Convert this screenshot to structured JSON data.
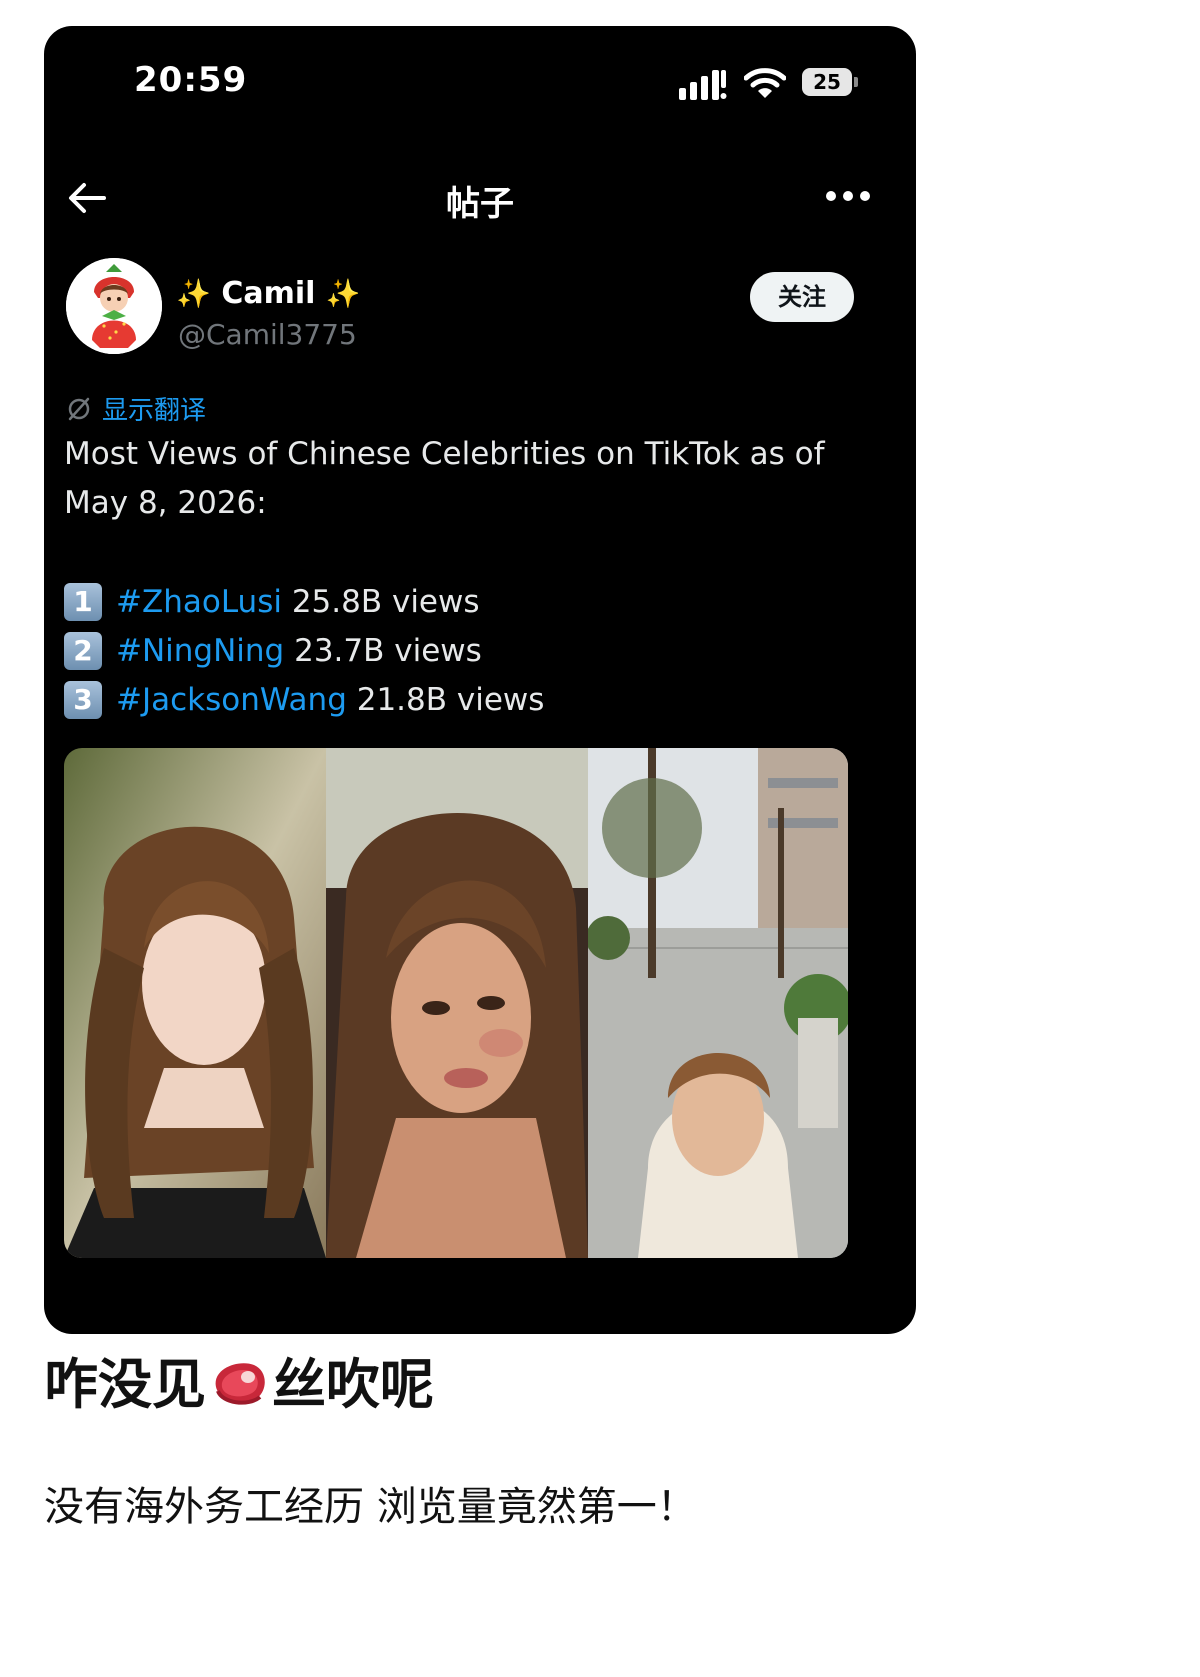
{
  "status_bar": {
    "time": "20:59",
    "battery": "25"
  },
  "nav": {
    "title": "帖子"
  },
  "author": {
    "display_name": "Camil",
    "sparkle": "✨",
    "handle": "@Camil3775",
    "follow_label": "关注"
  },
  "post": {
    "translate_label": "显示翻译",
    "text": "Most Views of Chinese Celebrities on TikTok as of May 8, 2026:",
    "rankings": [
      {
        "num": "1",
        "hashtag": "#ZhaoLusi",
        "views": "25.8B views"
      },
      {
        "num": "2",
        "hashtag": "#NingNing",
        "views": "23.7B views"
      },
      {
        "num": "3",
        "hashtag": "#JacksonWang",
        "views": "21.8B views"
      }
    ]
  },
  "caption": {
    "title_part1": "咋没见",
    "title_part2": "丝吹呢",
    "subtitle": "没有海外务工经历 浏览量竟然第一！"
  },
  "icons": {
    "back": "arrow-left-icon",
    "more": "more-horizontal-icon",
    "translate": "translate-icon",
    "signal": "signal-icon",
    "wifi": "wifi-icon",
    "emoji": "steak-emoji-icon"
  },
  "colors": {
    "accent": "#1d9bf0",
    "background": "#000000",
    "follow_button": "#eff3f4"
  }
}
